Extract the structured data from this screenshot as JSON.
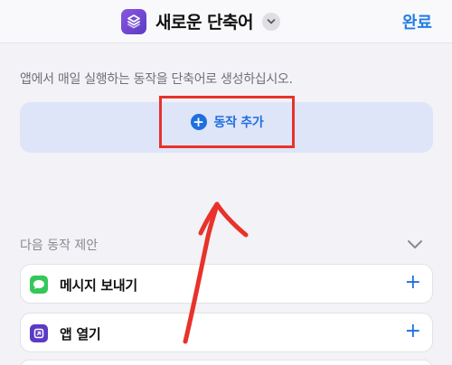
{
  "header": {
    "title": "새로운 단축어",
    "done_label": "완료",
    "app_icon": "shortcuts-icon",
    "accent_color": "#1f7de6"
  },
  "main": {
    "hint": "앱에서 매일 실행하는 동작을 단축어로 생성하십시오.",
    "add_action_label": "동작 추가"
  },
  "suggestions": {
    "title": "다음 동작 제안",
    "items": [
      {
        "label": "메시지 보내기",
        "icon": "messages-icon",
        "icon_color": "#34c759"
      },
      {
        "label": "앱 열기",
        "icon": "open-app-icon",
        "icon_color": "#5b3bc4"
      }
    ]
  },
  "annotation": {
    "highlight_color": "#e8322a",
    "arrow": "hand-drawn-arrow"
  }
}
